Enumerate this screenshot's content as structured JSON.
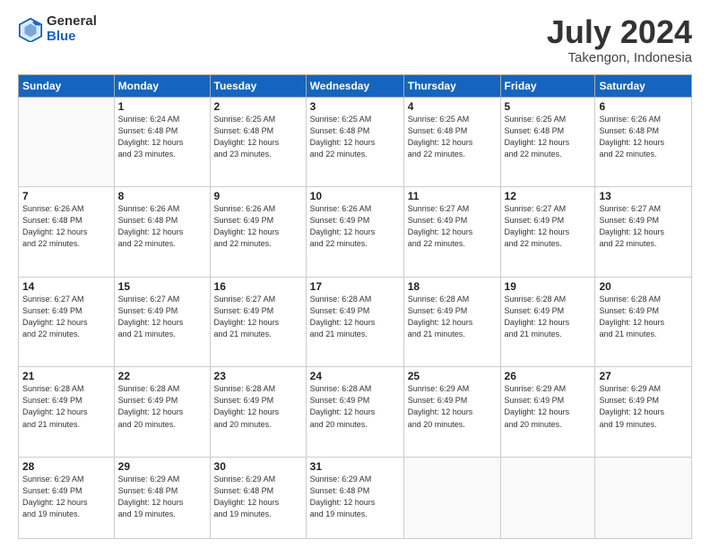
{
  "logo": {
    "general": "General",
    "blue": "Blue"
  },
  "title": {
    "month_year": "July 2024",
    "location": "Takengon, Indonesia"
  },
  "weekdays": [
    "Sunday",
    "Monday",
    "Tuesday",
    "Wednesday",
    "Thursday",
    "Friday",
    "Saturday"
  ],
  "weeks": [
    [
      {
        "day": "",
        "info": ""
      },
      {
        "day": "1",
        "info": "Sunrise: 6:24 AM\nSunset: 6:48 PM\nDaylight: 12 hours\nand 23 minutes."
      },
      {
        "day": "2",
        "info": "Sunrise: 6:25 AM\nSunset: 6:48 PM\nDaylight: 12 hours\nand 23 minutes."
      },
      {
        "day": "3",
        "info": "Sunrise: 6:25 AM\nSunset: 6:48 PM\nDaylight: 12 hours\nand 22 minutes."
      },
      {
        "day": "4",
        "info": "Sunrise: 6:25 AM\nSunset: 6:48 PM\nDaylight: 12 hours\nand 22 minutes."
      },
      {
        "day": "5",
        "info": "Sunrise: 6:25 AM\nSunset: 6:48 PM\nDaylight: 12 hours\nand 22 minutes."
      },
      {
        "day": "6",
        "info": "Sunrise: 6:26 AM\nSunset: 6:48 PM\nDaylight: 12 hours\nand 22 minutes."
      }
    ],
    [
      {
        "day": "7",
        "info": ""
      },
      {
        "day": "8",
        "info": "Sunrise: 6:26 AM\nSunset: 6:48 PM\nDaylight: 12 hours\nand 22 minutes."
      },
      {
        "day": "9",
        "info": "Sunrise: 6:26 AM\nSunset: 6:49 PM\nDaylight: 12 hours\nand 22 minutes."
      },
      {
        "day": "10",
        "info": "Sunrise: 6:26 AM\nSunset: 6:49 PM\nDaylight: 12 hours\nand 22 minutes."
      },
      {
        "day": "11",
        "info": "Sunrise: 6:27 AM\nSunset: 6:49 PM\nDaylight: 12 hours\nand 22 minutes."
      },
      {
        "day": "12",
        "info": "Sunrise: 6:27 AM\nSunset: 6:49 PM\nDaylight: 12 hours\nand 22 minutes."
      },
      {
        "day": "13",
        "info": "Sunrise: 6:27 AM\nSunset: 6:49 PM\nDaylight: 12 hours\nand 22 minutes."
      }
    ],
    [
      {
        "day": "14",
        "info": ""
      },
      {
        "day": "15",
        "info": "Sunrise: 6:27 AM\nSunset: 6:49 PM\nDaylight: 12 hours\nand 21 minutes."
      },
      {
        "day": "16",
        "info": "Sunrise: 6:27 AM\nSunset: 6:49 PM\nDaylight: 12 hours\nand 21 minutes."
      },
      {
        "day": "17",
        "info": "Sunrise: 6:28 AM\nSunset: 6:49 PM\nDaylight: 12 hours\nand 21 minutes."
      },
      {
        "day": "18",
        "info": "Sunrise: 6:28 AM\nSunset: 6:49 PM\nDaylight: 12 hours\nand 21 minutes."
      },
      {
        "day": "19",
        "info": "Sunrise: 6:28 AM\nSunset: 6:49 PM\nDaylight: 12 hours\nand 21 minutes."
      },
      {
        "day": "20",
        "info": "Sunrise: 6:28 AM\nSunset: 6:49 PM\nDaylight: 12 hours\nand 21 minutes."
      }
    ],
    [
      {
        "day": "21",
        "info": ""
      },
      {
        "day": "22",
        "info": "Sunrise: 6:28 AM\nSunset: 6:49 PM\nDaylight: 12 hours\nand 20 minutes."
      },
      {
        "day": "23",
        "info": "Sunrise: 6:28 AM\nSunset: 6:49 PM\nDaylight: 12 hours\nand 20 minutes."
      },
      {
        "day": "24",
        "info": "Sunrise: 6:28 AM\nSunset: 6:49 PM\nDaylight: 12 hours\nand 20 minutes."
      },
      {
        "day": "25",
        "info": "Sunrise: 6:29 AM\nSunset: 6:49 PM\nDaylight: 12 hours\nand 20 minutes."
      },
      {
        "day": "26",
        "info": "Sunrise: 6:29 AM\nSunset: 6:49 PM\nDaylight: 12 hours\nand 20 minutes."
      },
      {
        "day": "27",
        "info": "Sunrise: 6:29 AM\nSunset: 6:49 PM\nDaylight: 12 hours\nand 19 minutes."
      }
    ],
    [
      {
        "day": "28",
        "info": "Sunrise: 6:29 AM\nSunset: 6:49 PM\nDaylight: 12 hours\nand 19 minutes."
      },
      {
        "day": "29",
        "info": "Sunrise: 6:29 AM\nSunset: 6:48 PM\nDaylight: 12 hours\nand 19 minutes."
      },
      {
        "day": "30",
        "info": "Sunrise: 6:29 AM\nSunset: 6:48 PM\nDaylight: 12 hours\nand 19 minutes."
      },
      {
        "day": "31",
        "info": "Sunrise: 6:29 AM\nSunset: 6:48 PM\nDaylight: 12 hours\nand 19 minutes."
      },
      {
        "day": "",
        "info": ""
      },
      {
        "day": "",
        "info": ""
      },
      {
        "day": "",
        "info": ""
      }
    ]
  ],
  "week7_sunday_info": "Sunrise: 6:26 AM\nSunset: 6:48 PM\nDaylight: 12 hours\nand 22 minutes.",
  "week14_sunday_info": "Sunrise: 6:27 AM\nSunset: 6:49 PM\nDaylight: 12 hours\nand 22 minutes.",
  "week21_sunday_info": "Sunrise: 6:28 AM\nSunset: 6:49 PM\nDaylight: 12 hours\nand 21 minutes."
}
